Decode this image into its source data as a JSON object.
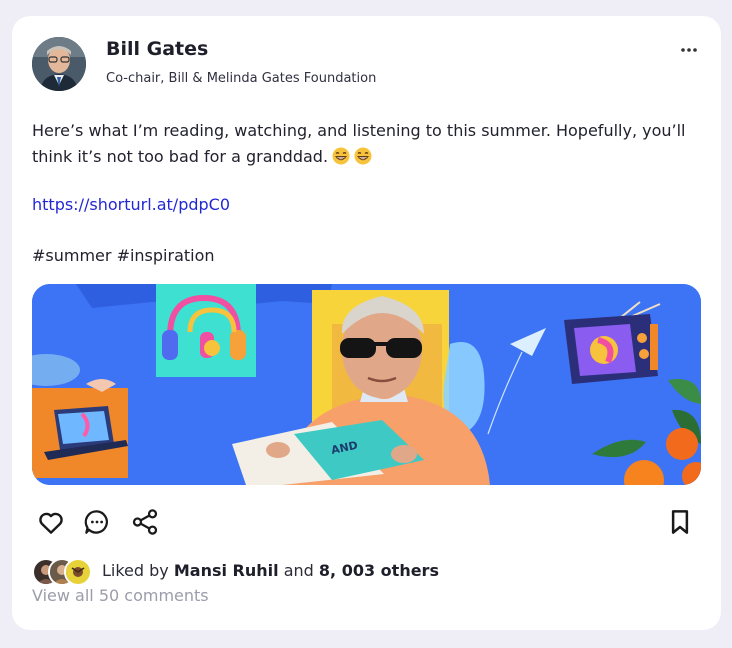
{
  "post": {
    "author": {
      "name": "Bill Gates",
      "title": "Co-chair, Bill & Melinda Gates Foundation",
      "avatar_icon": "profile-photo"
    },
    "text": "Here’s what I’m reading, watching, and listening to this summer. Hopefully, you’ll think it’s not too bad for a granddad.",
    "emojis": [
      "grinning-face-icon",
      "grinning-face-icon"
    ],
    "link": "https://shorturl.at/pdpC0",
    "hashtags": "#summer #inspiration",
    "image_alt_icon": "summer-collage-image"
  },
  "actions": {
    "like_icon": "heart-icon",
    "comment_icon": "comment-bubble-icon",
    "share_icon": "share-icon",
    "save_icon": "bookmark-icon",
    "more_icon": "more-horizontal-icon"
  },
  "likes": {
    "prefix": "Liked by",
    "name": "Mansi Ruhil",
    "connector": "and",
    "count": "8, 003 others"
  },
  "comments": {
    "label": "View all 50 comments"
  },
  "colors": {
    "background": "#efeef6",
    "card": "#ffffff",
    "link": "#2328d4",
    "muted": "#9c9cab",
    "hero_blue": "#3d74f5"
  }
}
